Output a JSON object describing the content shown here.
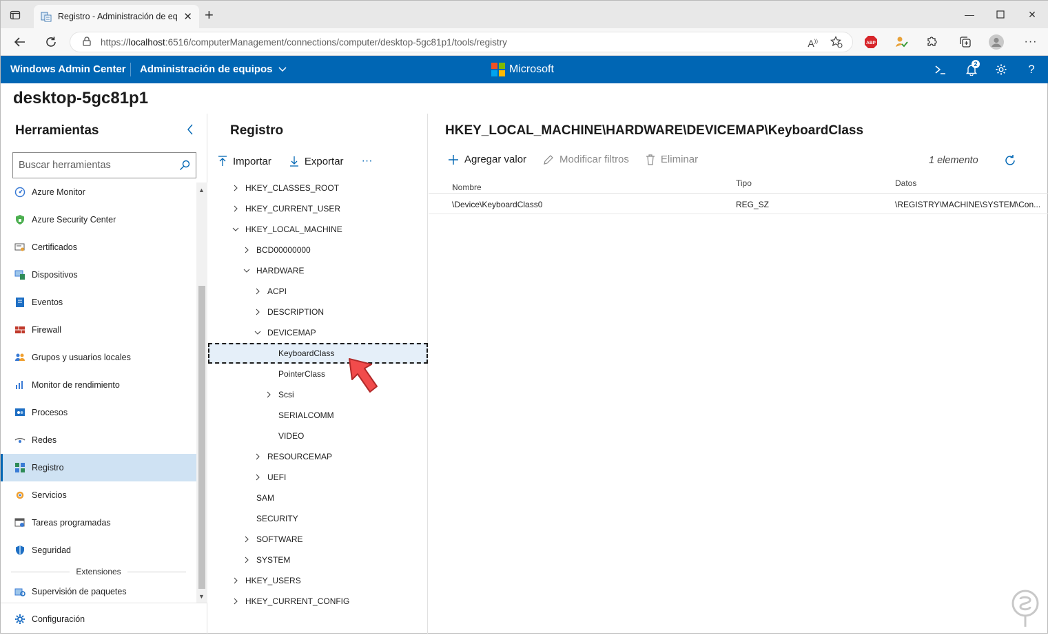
{
  "browser": {
    "tab_title": "Registro - Administración de eq",
    "url_prefix": "https://",
    "url_host": "localhost",
    "url_rest": ":6516/computerManagement/connections/computer/desktop-5gc81p1/tools/registry"
  },
  "header": {
    "app_title": "Windows Admin Center",
    "section": "Administración de equipos",
    "brand": "Microsoft",
    "notification_count": "2",
    "colors": {
      "bar": "#0066b4"
    }
  },
  "machine_name": "desktop-5gc81p1",
  "tools": {
    "title": "Herramientas",
    "search_placeholder": "Buscar herramientas",
    "items": [
      {
        "label": "Azure Monitor",
        "icon": "azure-monitor-icon"
      },
      {
        "label": "Azure Security Center",
        "icon": "shield-icon"
      },
      {
        "label": "Certificados",
        "icon": "certificate-icon"
      },
      {
        "label": "Dispositivos",
        "icon": "devices-icon"
      },
      {
        "label": "Eventos",
        "icon": "events-icon"
      },
      {
        "label": "Firewall",
        "icon": "firewall-icon"
      },
      {
        "label": "Grupos y usuarios locales",
        "icon": "users-icon"
      },
      {
        "label": "Monitor de rendimiento",
        "icon": "performance-icon"
      },
      {
        "label": "Procesos",
        "icon": "processes-icon"
      },
      {
        "label": "Redes",
        "icon": "network-icon"
      },
      {
        "label": "Registro",
        "icon": "registry-icon",
        "selected": true
      },
      {
        "label": "Servicios",
        "icon": "services-icon"
      },
      {
        "label": "Tareas programadas",
        "icon": "scheduled-tasks-icon"
      },
      {
        "label": "Seguridad",
        "icon": "security-icon"
      }
    ],
    "extensions_label": "Extensiones",
    "extensions": [
      {
        "label": "Supervisión de paquetes",
        "icon": "package-monitor-icon"
      }
    ],
    "settings_label": "Configuración"
  },
  "registry": {
    "title": "Registro",
    "import_label": "Importar",
    "export_label": "Exportar",
    "more_label": "···",
    "tree": [
      {
        "label": "HKEY_CLASSES_ROOT",
        "depth": 0,
        "chevron": "right"
      },
      {
        "label": "HKEY_CURRENT_USER",
        "depth": 0,
        "chevron": "right"
      },
      {
        "label": "HKEY_LOCAL_MACHINE",
        "depth": 0,
        "chevron": "down"
      },
      {
        "label": "BCD00000000",
        "depth": 1,
        "chevron": "right"
      },
      {
        "label": "HARDWARE",
        "depth": 1,
        "chevron": "down"
      },
      {
        "label": "ACPI",
        "depth": 2,
        "chevron": "right"
      },
      {
        "label": "DESCRIPTION",
        "depth": 2,
        "chevron": "right"
      },
      {
        "label": "DEVICEMAP",
        "depth": 2,
        "chevron": "down"
      },
      {
        "label": "KeyboardClass",
        "depth": 3,
        "chevron": "none",
        "selected": true
      },
      {
        "label": "PointerClass",
        "depth": 3,
        "chevron": "none"
      },
      {
        "label": "Scsi",
        "depth": 3,
        "chevron": "right"
      },
      {
        "label": "SERIALCOMM",
        "depth": 3,
        "chevron": "none"
      },
      {
        "label": "VIDEO",
        "depth": 3,
        "chevron": "none"
      },
      {
        "label": "RESOURCEMAP",
        "depth": 2,
        "chevron": "right"
      },
      {
        "label": "UEFI",
        "depth": 2,
        "chevron": "right"
      },
      {
        "label": "SAM",
        "depth": 1,
        "chevron": "none"
      },
      {
        "label": "SECURITY",
        "depth": 1,
        "chevron": "none"
      },
      {
        "label": "SOFTWARE",
        "depth": 1,
        "chevron": "right"
      },
      {
        "label": "SYSTEM",
        "depth": 1,
        "chevron": "right"
      },
      {
        "label": "HKEY_USERS",
        "depth": 0,
        "chevron": "right"
      },
      {
        "label": "HKEY_CURRENT_CONFIG",
        "depth": 0,
        "chevron": "right"
      }
    ]
  },
  "values_panel": {
    "path": "HKEY_LOCAL_MACHINE\\HARDWARE\\DEVICEMAP\\KeyboardClass",
    "add_label": "Agregar valor",
    "modify_filters_label": "Modificar filtros",
    "delete_label": "Eliminar",
    "count_label": "1 elemento",
    "columns": {
      "name": "Nombre",
      "type": "Tipo",
      "data": "Datos"
    },
    "rows": [
      {
        "name": "\\Device\\KeyboardClass0",
        "type": "REG_SZ",
        "data": "\\REGISTRY\\MACHINE\\SYSTEM\\Con..."
      }
    ]
  }
}
